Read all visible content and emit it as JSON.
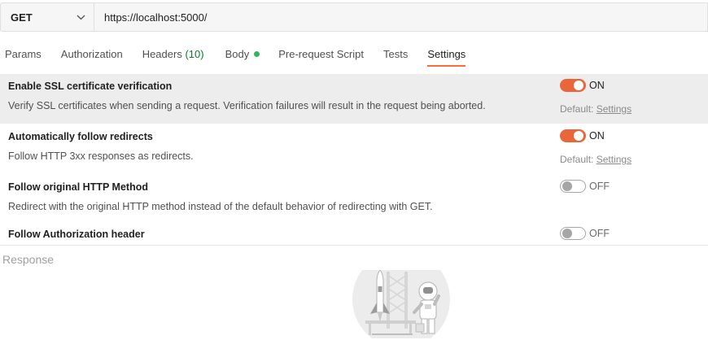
{
  "request": {
    "method": "GET",
    "url": "https://localhost:5000/"
  },
  "tabs": [
    {
      "label": "Params"
    },
    {
      "label": "Authorization"
    },
    {
      "label": "Headers",
      "count": "(10)"
    },
    {
      "label": "Body"
    },
    {
      "label": "Pre-request Script"
    },
    {
      "label": "Tests"
    },
    {
      "label": "Settings",
      "active": true
    }
  ],
  "settings": [
    {
      "title": "Enable SSL certificate verification",
      "description": "Verify SSL certificates when sending a request. Verification failures will result in the request being aborted.",
      "state": "ON",
      "default_prefix": "Default:",
      "default_link": "Settings"
    },
    {
      "title": "Automatically follow redirects",
      "description": "Follow HTTP 3xx responses as redirects.",
      "state": "ON",
      "default_prefix": "Default:",
      "default_link": "Settings"
    },
    {
      "title": "Follow original HTTP Method",
      "description": "Redirect with the original HTTP method instead of the default behavior of redirecting with GET.",
      "state": "OFF"
    },
    {
      "title": "Follow Authorization header",
      "state": "OFF"
    }
  ],
  "response": {
    "label": "Response"
  },
  "colors": {
    "accent": "#ff6c37",
    "toggle_on": "#e8663a",
    "headers_count": "#0b7a2a",
    "body_dot": "#2fb55a"
  },
  "icons": {
    "method_dropdown": "chevron-down-icon",
    "body_status": "status-dot-icon",
    "response_empty": "astronaut-rocket-illustration"
  }
}
